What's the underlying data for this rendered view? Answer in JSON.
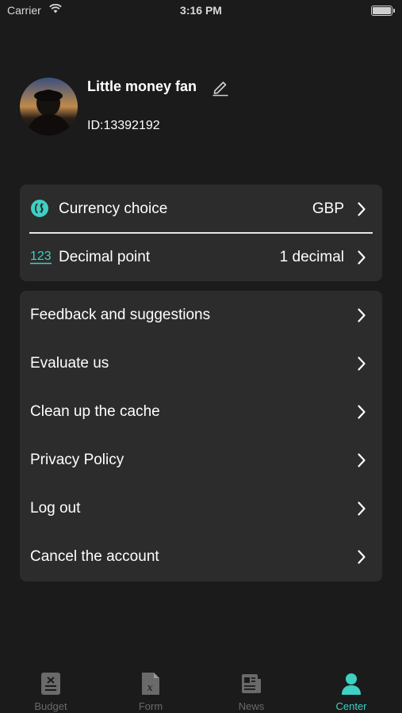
{
  "status_bar": {
    "carrier": "Carrier",
    "time": "3:16 PM"
  },
  "profile": {
    "name": "Little money fan",
    "id": "ID:13392192"
  },
  "settings": {
    "items": [
      {
        "label": "Currency choice",
        "value": "GBP",
        "icon": "currency-icon"
      },
      {
        "label": "Decimal point",
        "value": "1 decimal",
        "icon": "numbers-icon",
        "icon_text": "123"
      }
    ]
  },
  "menu": {
    "items": [
      {
        "label": "Feedback and suggestions"
      },
      {
        "label": "Evaluate us"
      },
      {
        "label": "Clean up the cache"
      },
      {
        "label": "Privacy Policy"
      },
      {
        "label": "Log out"
      },
      {
        "label": "Cancel the account"
      }
    ]
  },
  "tabs": [
    {
      "label": "Budget",
      "icon": "budget-icon",
      "active": false
    },
    {
      "label": "Form",
      "icon": "form-icon",
      "active": false
    },
    {
      "label": "News",
      "icon": "news-icon",
      "active": false
    },
    {
      "label": "Center",
      "icon": "person-icon",
      "active": true
    }
  ],
  "colors": {
    "accent": "#3fd0c4",
    "background": "#1b1b1b",
    "card": "#2c2c2c",
    "inactive_tab": "#6a6a6a"
  }
}
